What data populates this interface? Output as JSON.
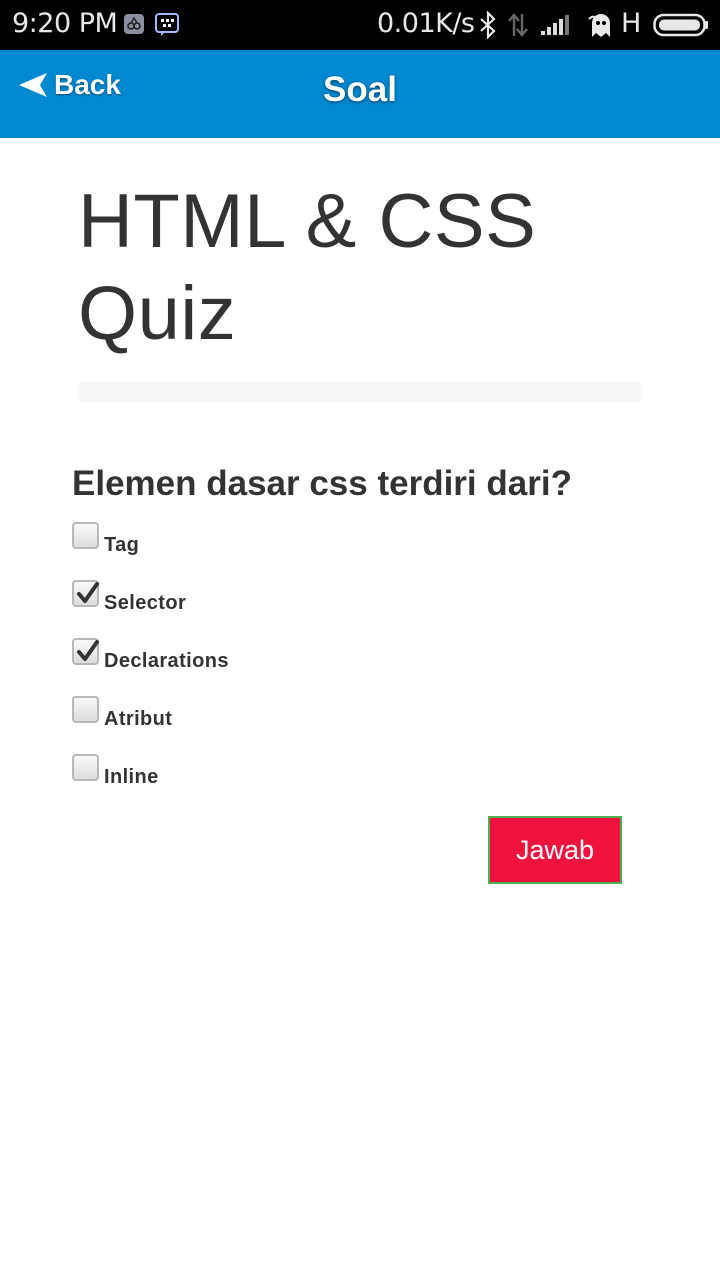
{
  "status_bar": {
    "time": "9:20 PM",
    "net_speed": "0.01K/s",
    "network_type": "H",
    "icons": [
      "app-notification-icon",
      "bbm-icon",
      "bluetooth-icon",
      "data-arrows-icon",
      "signal-icon",
      "ghost-icon",
      "battery-icon"
    ],
    "battery_level": 1.0
  },
  "app_bar": {
    "back_label": "Back",
    "title": "Soal",
    "color": "#0088d1"
  },
  "quiz": {
    "title": "HTML & CSS Quiz",
    "progress": 0,
    "question": "Elemen dasar css terdiri dari?",
    "options": [
      {
        "label": "Tag",
        "checked": false
      },
      {
        "label": "Selector",
        "checked": true
      },
      {
        "label": "Declarations",
        "checked": true
      },
      {
        "label": "Atribut",
        "checked": false
      },
      {
        "label": "Inline",
        "checked": false
      }
    ],
    "submit_label": "Jawab",
    "submit_color": "#f0123e"
  }
}
